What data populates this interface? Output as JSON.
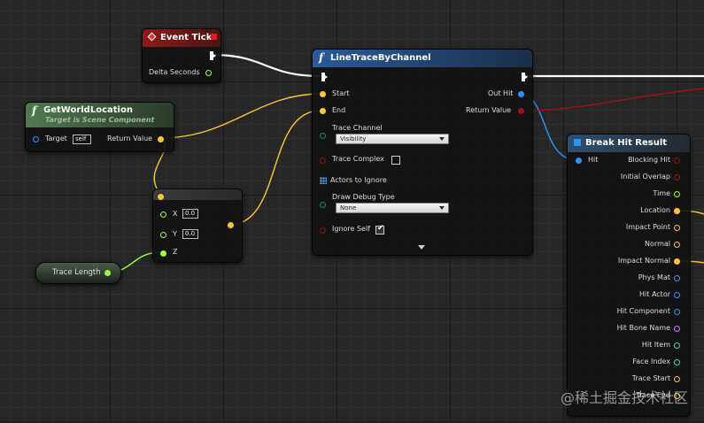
{
  "colors": {
    "event_header": "#8f1a1a",
    "function_header": "#2a4f7c",
    "pure_header": "#4a6a4a",
    "break_header": "#2f4b66",
    "float_pin": "#9bff3b",
    "vector_pin": "#ffc72d",
    "bool_pin": "#9e1111",
    "object_pin": "#2c94ff",
    "struct_pin": "#0d5fa8",
    "enum_pin": "#0c6e63",
    "exec_wire": "#ffffff"
  },
  "event_tick": {
    "title": "Event Tick",
    "output_delta_seconds": "Delta Seconds"
  },
  "get_world_location": {
    "title": "GetWorldLocation",
    "subtitle": "Target is Scene Component",
    "input_target": "Target",
    "target_value": "self",
    "output_return_value": "Return Value"
  },
  "make_vector": {
    "x_label": "X",
    "x_value": "0.0",
    "y_label": "Y",
    "y_value": "0.0",
    "z_label": "Z"
  },
  "trace_length": {
    "label": "Trace Length"
  },
  "line_trace": {
    "title": "LineTraceByChannel",
    "input_start": "Start",
    "input_end": "End",
    "trace_channel_label": "Trace Channel",
    "trace_channel_value": "Visibility",
    "trace_complex_label": "Trace Complex",
    "actors_to_ignore_label": "Actors to Ignore",
    "draw_debug_type_label": "Draw Debug Type",
    "draw_debug_type_value": "None",
    "ignore_self_label": "Ignore Self",
    "output_out_hit": "Out Hit",
    "output_return_value": "Return Value"
  },
  "break_hit_result": {
    "title": "Break Hit Result",
    "input_hit": "Hit",
    "outputs": [
      {
        "label": "Blocking Hit",
        "type": "bool"
      },
      {
        "label": "Initial Overlap",
        "type": "bool"
      },
      {
        "label": "Time",
        "type": "float"
      },
      {
        "label": "Location",
        "type": "vector"
      },
      {
        "label": "Impact Point",
        "type": "vector"
      },
      {
        "label": "Normal",
        "type": "vector"
      },
      {
        "label": "Impact Normal",
        "type": "vector"
      },
      {
        "label": "Phys Mat",
        "type": "object"
      },
      {
        "label": "Hit Actor",
        "type": "object"
      },
      {
        "label": "Hit Component",
        "type": "object"
      },
      {
        "label": "Hit Bone Name",
        "type": "name"
      },
      {
        "label": "Hit Item",
        "type": "int"
      },
      {
        "label": "Face Index",
        "type": "int"
      },
      {
        "label": "Trace Start",
        "type": "vector"
      },
      {
        "label": "Trace End",
        "type": "vector"
      }
    ]
  },
  "watermark": "@稀土掘金技术社区"
}
